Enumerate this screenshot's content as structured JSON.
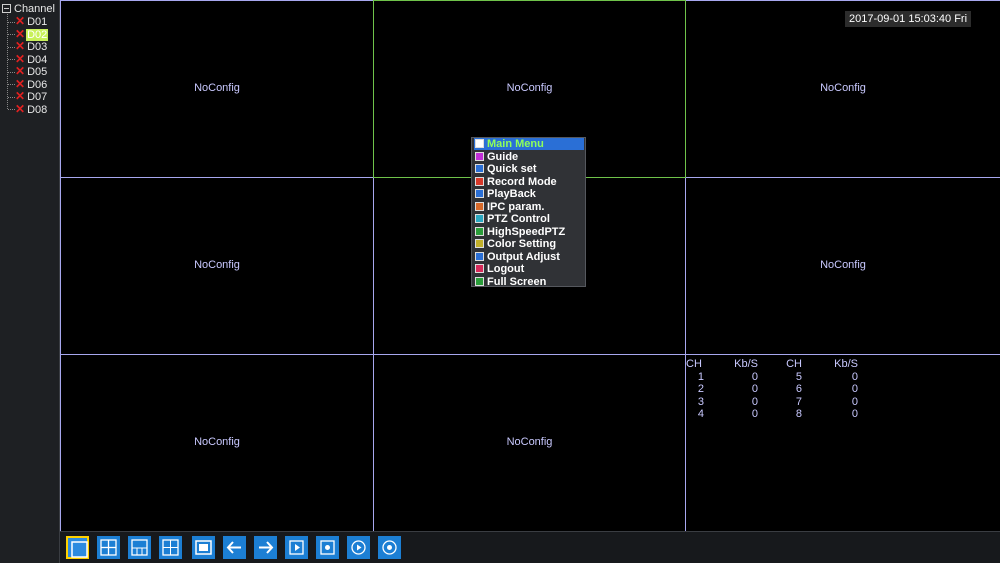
{
  "sidebar": {
    "root_label": "Channel",
    "channels": [
      "D01",
      "D02",
      "D03",
      "D04",
      "D05",
      "D06",
      "D07",
      "D08"
    ],
    "selected": "D02"
  },
  "grid": {
    "cells": [
      "NoConfig",
      "NoConfig",
      "NoConfig",
      "NoConfig",
      "NoConfig",
      "NoConfig",
      "NoConfig",
      "NoConfig"
    ]
  },
  "clock": "2017-09-01 15:03:40 Fri",
  "stats": {
    "headers": [
      "CH",
      "Kb/S",
      "CH",
      "Kb/S"
    ],
    "rows": [
      [
        "1",
        "0",
        "5",
        "0"
      ],
      [
        "2",
        "0",
        "6",
        "0"
      ],
      [
        "3",
        "0",
        "7",
        "0"
      ],
      [
        "4",
        "0",
        "8",
        "0"
      ]
    ]
  },
  "context_menu": {
    "items": [
      {
        "label": "Main Menu",
        "icon": "home-icon",
        "color": "#ffffff"
      },
      {
        "label": "Guide",
        "icon": "guide-icon",
        "color": "#c22fd8"
      },
      {
        "label": "Quick set",
        "icon": "quickset-icon",
        "color": "#2a6fd6"
      },
      {
        "label": "Record Mode",
        "icon": "record-icon",
        "color": "#d8392a"
      },
      {
        "label": "PlayBack",
        "icon": "playback-icon",
        "color": "#2a6fd6"
      },
      {
        "label": "IPC param.",
        "icon": "ipc-icon",
        "color": "#d86a2a"
      },
      {
        "label": "PTZ Control",
        "icon": "ptz-icon",
        "color": "#2aa8c2"
      },
      {
        "label": "HighSpeedPTZ",
        "icon": "highspeed-icon",
        "color": "#2a9d3a"
      },
      {
        "label": "Color Setting",
        "icon": "color-icon",
        "color": "#c2b02a"
      },
      {
        "label": "Output Adjust",
        "icon": "output-icon",
        "color": "#2a6fd6"
      },
      {
        "label": "Logout",
        "icon": "logout-icon",
        "color": "#d82a5a"
      },
      {
        "label": "Full Screen",
        "icon": "fullscreen-icon",
        "color": "#2a9d3a"
      }
    ],
    "highlighted": 0
  },
  "toolbar": {
    "buttons": [
      "single-view-icon",
      "quad-view-icon",
      "six-view-icon",
      "nine-view-icon",
      "sixteen-view-icon",
      "previous-icon",
      "next-icon",
      "play-icon",
      "record-icon",
      "playback-icon",
      "settings-icon"
    ],
    "active": 0
  }
}
